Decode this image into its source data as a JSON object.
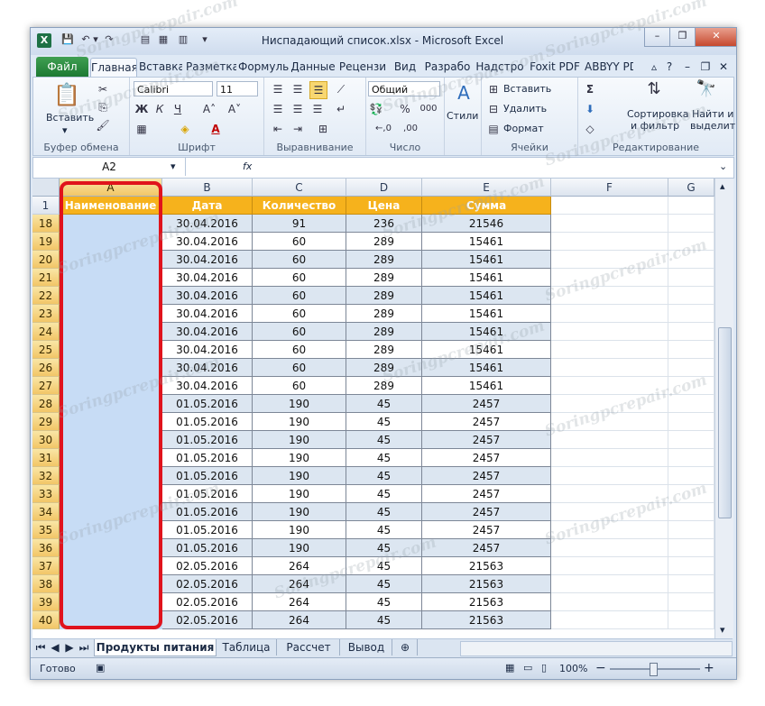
{
  "window": {
    "title": "Ниспадающий список.xlsx  -  Microsoft Excel",
    "app_icon": "X",
    "minimize_glyph": "–",
    "restore_glyph": "❐",
    "close_glyph": "✕"
  },
  "quick_access": {
    "save_icon": "💾",
    "undo_icon": "↶",
    "undo_drop": "▾",
    "redo_icon": "↷",
    "form_icon": "▤",
    "extra1_icon": "▦",
    "extra2_icon": "▥",
    "customize_icon": "▾"
  },
  "tabs": {
    "file": "Файл",
    "items": [
      "Главная",
      "Вставка",
      "Разметка",
      "Формуль",
      "Данные",
      "Рецензи",
      "Вид",
      "Разрабо",
      "Надстро",
      "Foxit PDF",
      "ABBYY PD"
    ],
    "help_icons": [
      "▵",
      "?",
      "–",
      "❐",
      "✕"
    ]
  },
  "ribbon": {
    "clipboard": {
      "label": "Буфер обмена",
      "paste": "Вставить",
      "paste_drop": "▾",
      "cut_icon": "✂",
      "copy_icon": "⎘",
      "format_icon": "🖌"
    },
    "font": {
      "label": "Шрифт",
      "name": "Calibri",
      "size": "11",
      "bold": "Ж",
      "italic": "К",
      "underline": "Ч",
      "grow": "A˄",
      "shrink": "A˅",
      "border": "▦",
      "fill": "◈",
      "color": "A"
    },
    "alignment": {
      "label": "Выравнивание"
    },
    "number": {
      "label": "Число",
      "format": "Общий",
      "currency": "💱",
      "percent": "%",
      "thousands": "000",
      "inc": "←,0",
      "dec": ",00"
    },
    "styles": {
      "label": "Стили"
    },
    "cells": {
      "label": "Ячейки",
      "insert": "Вставить",
      "delete": "Удалить",
      "format": "Формат"
    },
    "editing": {
      "label": "Редактирование",
      "sum": "Σ",
      "sort": "Сортировка",
      "sort2": "и фильтр",
      "find": "Найти и",
      "find2": "выделить",
      "fill_icon": "⬇",
      "clear_icon": "◇"
    }
  },
  "formula_bar": {
    "name_box": "A2",
    "fx": "fx",
    "value": ""
  },
  "columns": [
    "A",
    "B",
    "C",
    "D",
    "E",
    "F",
    "G"
  ],
  "header_row": {
    "num": "1",
    "cells": [
      "Наименование",
      "Дата",
      "Количество",
      "Цена",
      "Сумма"
    ]
  },
  "rows": [
    {
      "num": "18",
      "date": "30.04.2016",
      "qty": "91",
      "price": "236",
      "sum": "21546"
    },
    {
      "num": "19",
      "date": "30.04.2016",
      "qty": "60",
      "price": "289",
      "sum": "15461"
    },
    {
      "num": "20",
      "date": "30.04.2016",
      "qty": "60",
      "price": "289",
      "sum": "15461"
    },
    {
      "num": "21",
      "date": "30.04.2016",
      "qty": "60",
      "price": "289",
      "sum": "15461"
    },
    {
      "num": "22",
      "date": "30.04.2016",
      "qty": "60",
      "price": "289",
      "sum": "15461"
    },
    {
      "num": "23",
      "date": "30.04.2016",
      "qty": "60",
      "price": "289",
      "sum": "15461"
    },
    {
      "num": "24",
      "date": "30.04.2016",
      "qty": "60",
      "price": "289",
      "sum": "15461"
    },
    {
      "num": "25",
      "date": "30.04.2016",
      "qty": "60",
      "price": "289",
      "sum": "15461"
    },
    {
      "num": "26",
      "date": "30.04.2016",
      "qty": "60",
      "price": "289",
      "sum": "15461"
    },
    {
      "num": "27",
      "date": "30.04.2016",
      "qty": "60",
      "price": "289",
      "sum": "15461"
    },
    {
      "num": "28",
      "date": "01.05.2016",
      "qty": "190",
      "price": "45",
      "sum": "2457"
    },
    {
      "num": "29",
      "date": "01.05.2016",
      "qty": "190",
      "price": "45",
      "sum": "2457"
    },
    {
      "num": "30",
      "date": "01.05.2016",
      "qty": "190",
      "price": "45",
      "sum": "2457"
    },
    {
      "num": "31",
      "date": "01.05.2016",
      "qty": "190",
      "price": "45",
      "sum": "2457"
    },
    {
      "num": "32",
      "date": "01.05.2016",
      "qty": "190",
      "price": "45",
      "sum": "2457"
    },
    {
      "num": "33",
      "date": "01.05.2016",
      "qty": "190",
      "price": "45",
      "sum": "2457"
    },
    {
      "num": "34",
      "date": "01.05.2016",
      "qty": "190",
      "price": "45",
      "sum": "2457"
    },
    {
      "num": "35",
      "date": "01.05.2016",
      "qty": "190",
      "price": "45",
      "sum": "2457"
    },
    {
      "num": "36",
      "date": "01.05.2016",
      "qty": "190",
      "price": "45",
      "sum": "2457"
    },
    {
      "num": "37",
      "date": "02.05.2016",
      "qty": "264",
      "price": "45",
      "sum": "21563"
    },
    {
      "num": "38",
      "date": "02.05.2016",
      "qty": "264",
      "price": "45",
      "sum": "21563"
    },
    {
      "num": "39",
      "date": "02.05.2016",
      "qty": "264",
      "price": "45",
      "sum": "21563"
    },
    {
      "num": "40",
      "date": "02.05.2016",
      "qty": "264",
      "price": "45",
      "sum": "21563"
    }
  ],
  "sheets": {
    "nav": [
      "⏮",
      "◀",
      "▶",
      "⏭"
    ],
    "tabs": [
      "Продукты питания",
      "Таблица",
      "Рассчет",
      "Вывод"
    ],
    "new_sheet_icon": "⊕"
  },
  "status": {
    "ready": "Готово",
    "zoom": "100%",
    "minus": "−",
    "plus": "+"
  },
  "watermark": "Soringpcrepair.com",
  "colors": {
    "accent": "#f6b21c",
    "highlight": "#e0131c",
    "selection": "#c7dcf5"
  }
}
